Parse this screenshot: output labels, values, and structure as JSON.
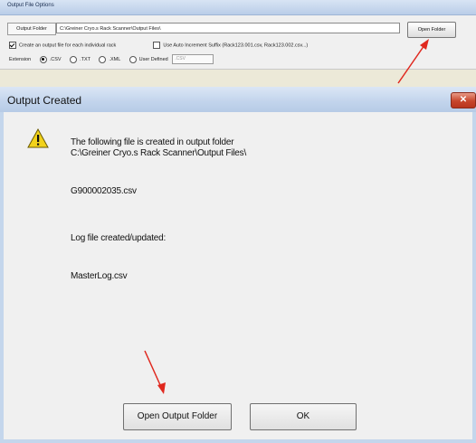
{
  "options_panel": {
    "title": "Output File Options",
    "output_folder_label": "Output Folder",
    "output_folder_path": "C:\\Greiner Cryo.s Rack Scanner\\Output Files\\",
    "open_folder_label": "Open Folder",
    "create_file_checkbox_label": "Create an output file for each individual rack",
    "auto_increment_label": "Use Auto Increment Suffix (Rack123.001.csv, Rack123.002.csv...)",
    "extension_label": "Extension",
    "extensions": [
      {
        "label": ".CSV",
        "selected": true
      },
      {
        "label": ".TXT",
        "selected": false
      },
      {
        "label": ".XML",
        "selected": false
      },
      {
        "label": "User Defined",
        "selected": false
      }
    ],
    "user_defined_value": ".CSV"
  },
  "dialog": {
    "title": "Output Created",
    "close_glyph": "✕",
    "message_line1": "The following file is created in output folder",
    "message_line2": "C:\\Greiner Cryo.s Rack Scanner\\Output Files\\",
    "file_name": "G900002035.csv",
    "log_message": "Log file created/updated:",
    "log_file": "MasterLog.csv",
    "open_output_folder_label": "Open Output Folder",
    "ok_label": "OK"
  },
  "colors": {
    "annotation_arrow": "#e0281e",
    "warning_yellow": "#f2d21b",
    "close_button": "#c7452b"
  },
  "icons": {
    "warning": "warning-icon",
    "close": "close-icon"
  }
}
